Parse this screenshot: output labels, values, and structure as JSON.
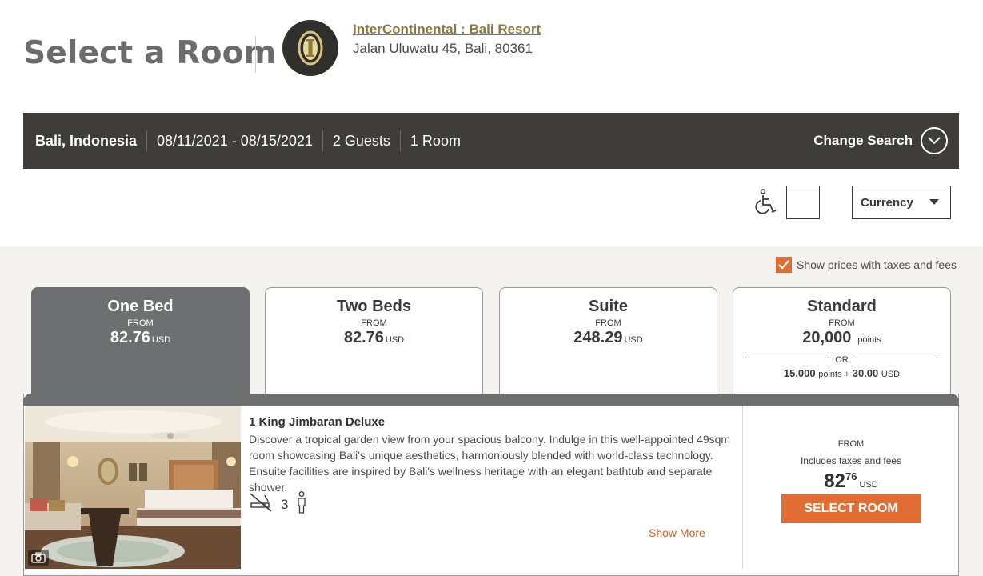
{
  "header": {
    "page_title": "Select a Room",
    "hotel_name": "InterContinental : Bali Resort",
    "hotel_address": "Jalan Uluwatu 45, Bali, 80361"
  },
  "search": {
    "location": "Bali, Indonesia",
    "dates": "08/11/2021 - 08/15/2021",
    "guests": "2 Guests",
    "rooms": "1 Room",
    "change_label": "Change Search"
  },
  "filters": {
    "currency_label": "Currency",
    "tax_label": "Show prices with taxes and fees",
    "tax_checked": true
  },
  "tabs": [
    {
      "name": "One Bed",
      "from": "FROM",
      "price": "82.76",
      "unit": "USD",
      "active": true
    },
    {
      "name": "Two Beds",
      "from": "FROM",
      "price": "82.76",
      "unit": "USD",
      "active": false
    },
    {
      "name": "Suite",
      "from": "FROM",
      "price": "248.29",
      "unit": "USD",
      "active": false
    },
    {
      "name": "Standard",
      "from": "FROM",
      "price": "20,000",
      "unit": "points",
      "or": "OR",
      "combo_points": "15,000",
      "combo_points_label": "points +",
      "combo_cash": "30.00",
      "combo_unit": "USD",
      "active": false
    }
  ],
  "room": {
    "title": "1 King Jimbaran Deluxe",
    "description": "Discover a tropical garden view from your spacious balcony. Indulge in this well-appointed 49sqm room showcasing Bali's unique aesthetics, harmoniously blended with world-class technology. Ensuite facilities are inspired by Bali's wellness heritage with an elegant bathtub and separate shower.",
    "occupancy": "3",
    "show_more": "Show More",
    "price_from": "FROM",
    "price_includes": "Includes taxes and fees",
    "price_whole": "82",
    "price_cents": "76",
    "price_unit": "USD",
    "select_label": "SELECT ROOM"
  },
  "colors": {
    "accent": "#e06d33",
    "bar": "#3f3d3c",
    "tab_active": "#6e6f70",
    "gold": "#8a7a3a"
  },
  "icons": [
    "hotel-logo-icon",
    "chevron-down-icon",
    "wheelchair-icon",
    "caret-down-icon",
    "check-icon",
    "no-smoking-icon",
    "person-icon",
    "camera-icon"
  ]
}
